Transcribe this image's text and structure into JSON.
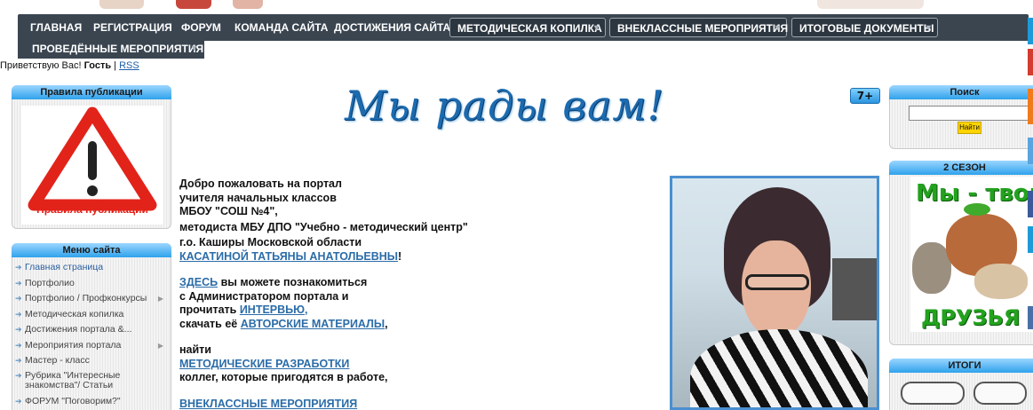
{
  "nav": {
    "row1": [
      {
        "label": "ГЛАВНАЯ",
        "dropdown": false
      },
      {
        "label": "РЕГИСТРАЦИЯ",
        "dropdown": false
      },
      {
        "label": "ФОРУМ",
        "dropdown": false
      },
      {
        "label": "КОМАНДА САЙТА",
        "dropdown": false
      },
      {
        "label": "ДОСТИЖЕНИЯ САЙТА",
        "dropdown": false
      },
      {
        "label": "МЕТОДИЧЕСКАЯ КОПИЛКА",
        "dropdown": true
      },
      {
        "label": "ВНЕКЛАССНЫЕ МЕРОПРИЯТИЯ",
        "dropdown": true
      },
      {
        "label": "ИТОГОВЫЕ ДОКУМЕНТЫ",
        "dropdown": true
      }
    ],
    "row2": [
      {
        "label": "ПРОВЕДЁННЫЕ МЕРОПРИЯТИЯ",
        "dropdown": true
      }
    ],
    "dropdown_arrow": "▾"
  },
  "greeting": {
    "prefix": "Приветствую Вас!",
    "user": "Гость",
    "separator": "|",
    "rss": "RSS"
  },
  "left": {
    "rules": {
      "title": "Правила публикации",
      "image_caption": "Правила публикации"
    },
    "menu": {
      "title": "Меню сайта",
      "items": [
        {
          "label": "Главная страница",
          "sub": false
        },
        {
          "label": "Портфолио",
          "sub": false
        },
        {
          "label": "Портфолио / Профконкурсы",
          "sub": true
        },
        {
          "label": "Методическая копилка",
          "sub": false
        },
        {
          "label": "Достижения портала &...",
          "sub": false
        },
        {
          "label": "Мероприятия портала",
          "sub": true
        },
        {
          "label": "Мастер - класс",
          "sub": false
        },
        {
          "label": "Рубрика \"Интересные знакомства\"/ Статьи",
          "sub": false
        },
        {
          "label": "ФОРУМ \"Поговорим?\"",
          "sub": false
        }
      ]
    }
  },
  "center": {
    "banner": "Мы рады вам!",
    "age_badge": "7+",
    "lines": {
      "l1": "Добро пожаловать на портал",
      "l2": "учителя начальных классов",
      "l3": "МБОУ \"СОШ №4\",",
      "l4": "методиста МБУ ДПО \"Учебно - методический центр\"",
      "l5": "г.о. Каширы  Московской области",
      "name_link": "КАСАТИНОЙ ТАТЬЯНЫ АНАТОЛЬЕВНЫ",
      "name_suffix": "!",
      "here_link": "ЗДЕСЬ",
      "here_rest": " вы можете познакомиться",
      "l8": "с Администратором портала и",
      "l9_prefix": "прочитать ",
      "interview_link": "ИНТЕРВЬЮ,",
      "l10_prefix": "скачать её ",
      "materials_link": "АВТОРСКИЕ МАТЕРИАЛЫ",
      "l10_suffix": ",",
      "find": "найти",
      "methods_link": "МЕТОДИЧЕСКИЕ РАЗРАБОТКИ",
      "colleagues": "коллег, которые пригодятся в работе,",
      "events_link": "ВНЕКЛАССНЫЕ МЕРОПРИЯТИЯ"
    }
  },
  "right": {
    "search": {
      "title": "Поиск",
      "input_value": "",
      "button": "Найти"
    },
    "season": {
      "title": "2 СЕЗОН",
      "text_top": "Мы - твои",
      "text_bottom": "ДРУЗЬЯ"
    },
    "itogi": {
      "title": "ИТОГИ"
    }
  },
  "colors": {
    "nav_bg": "#3a4550",
    "block_header": "#2fa2ec",
    "link": "#2b6ca8",
    "accent_yellow": "#ffd400",
    "green_text": "#23a21e"
  },
  "icons": {
    "warning": "warning-triangle-icon",
    "menu_bullet": "arrow-right-icon",
    "submenu": "chevron-right-icon"
  }
}
